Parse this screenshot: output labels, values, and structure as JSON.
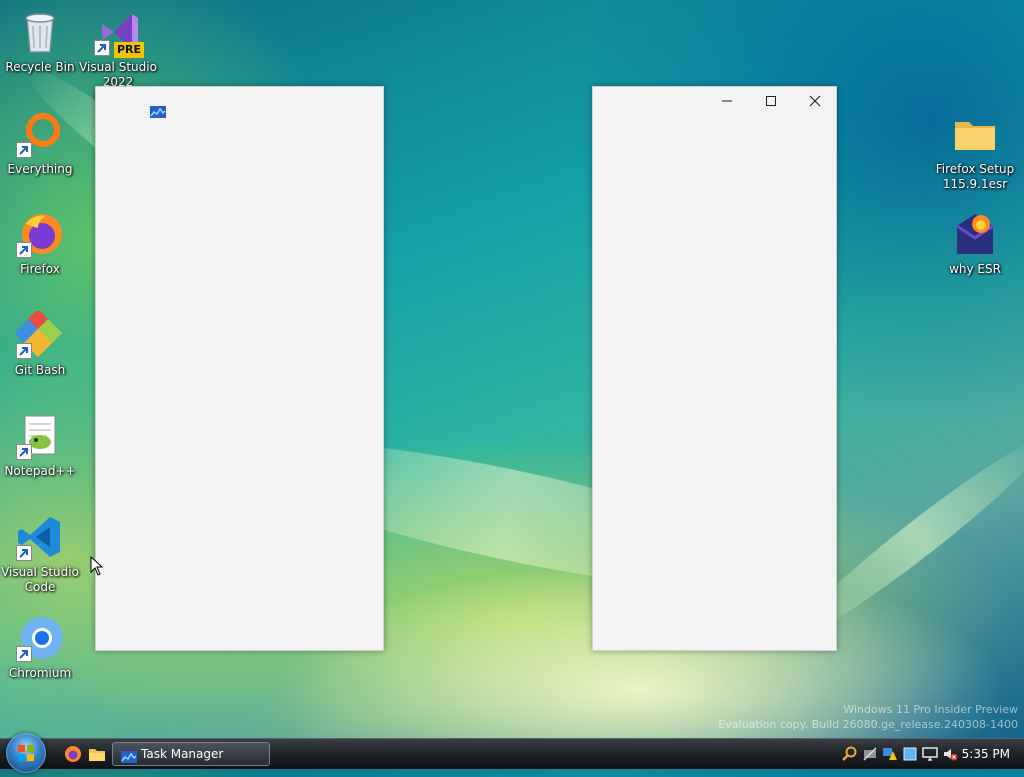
{
  "desktop": {
    "icons_left": [
      {
        "label": "Recycle Bin"
      },
      {
        "label": "Visual Studio 2022 Preview",
        "badge": "PRE"
      },
      {
        "label": "Everything"
      },
      {
        "label": "Firefox"
      },
      {
        "label": "Git Bash"
      },
      {
        "label": "Notepad++"
      },
      {
        "label": "Visual Studio Code"
      },
      {
        "label": "Chromium"
      }
    ],
    "icons_right": [
      {
        "label": "Firefox Setup 115.9.1esr"
      },
      {
        "label": "why ESR"
      }
    ],
    "watermark": {
      "line1": "Windows 11 Pro Insider Preview",
      "line2": "Evaluation copy. Build 26080.ge_release.240308-1400"
    }
  },
  "taskbar": {
    "task_label": "Task Manager",
    "clock": "5:35 PM"
  },
  "colors": {
    "window_bg": "#f3f3f3",
    "taskbar_dark": "#20252a"
  }
}
